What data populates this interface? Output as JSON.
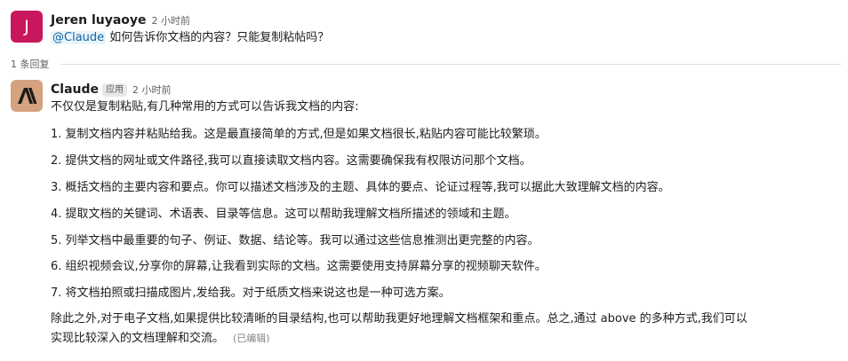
{
  "thread": {
    "first": {
      "avatar_letter": "J",
      "author": "Jeren luyaoye",
      "time": "2 小时前",
      "mention": "@Claude",
      "text": " 如何告诉你文档的内容？只能复制粘帖吗？"
    },
    "reply_count": "1 条回复",
    "reply": {
      "author": "Claude",
      "badge": "应用",
      "time": "2 小时前",
      "intro": "不仅仅是复制粘贴,有几种常用的方式可以告诉我文档的内容:",
      "items": [
        "1. 复制文档内容并粘贴给我。这是最直接简单的方式,但是如果文档很长,粘贴内容可能比较繁琐。",
        "2. 提供文档的网址或文件路径,我可以直接读取文档内容。这需要确保我有权限访问那个文档。",
        "3. 概括文档的主要内容和要点。你可以描述文档涉及的主题、具体的要点、论证过程等,我可以据此大致理解文档的内容。",
        "4. 提取文档的关键词、术语表、目录等信息。这可以帮助我理解文档所描述的领域和主题。",
        "5. 列举文档中最重要的句子、例证、数据、结论等。我可以通过这些信息推测出更完整的内容。",
        "6. 组织视频会议,分享你的屏幕,让我看到实际的文档。这需要使用支持屏幕分享的视频聊天软件。",
        "7. 将文档拍照或扫描成图片,发给我。对于纸质文档来说这也是一种可选方案。"
      ],
      "closing_line1": "除此之外,对于电子文档,如果提供比较清晰的目录结构,也可以帮助我更好地理解文档框架和重点。总之,通过 above 的多种方式,我们可以",
      "closing_line2": "实现比较深入的文档理解和交流。",
      "edited": "(已编辑)"
    }
  }
}
